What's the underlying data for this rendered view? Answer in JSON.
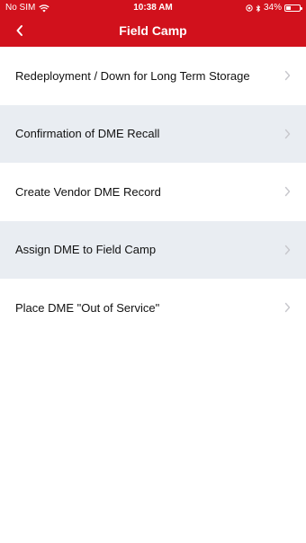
{
  "status_bar": {
    "carrier": "No SIM",
    "time": "10:38 AM",
    "battery_percent": "34%",
    "battery_level": 0.34,
    "icons": [
      "wifi-icon",
      "location-icon",
      "bluetooth-icon",
      "battery-icon"
    ]
  },
  "header": {
    "title": "Field Camp",
    "back_icon": "chevron-left-icon",
    "background_color": "#d1111c"
  },
  "menu": {
    "items": [
      {
        "label": "Redeployment / Down for Long Term Storage"
      },
      {
        "label": "Confirmation of DME Recall"
      },
      {
        "label": "Create Vendor DME Record"
      },
      {
        "label": "Assign DME to Field Camp"
      },
      {
        "label": "Place DME \"Out of Service\""
      }
    ],
    "alt_row_color": "#e9edf2",
    "chevron_icon": "chevron-right-icon"
  }
}
